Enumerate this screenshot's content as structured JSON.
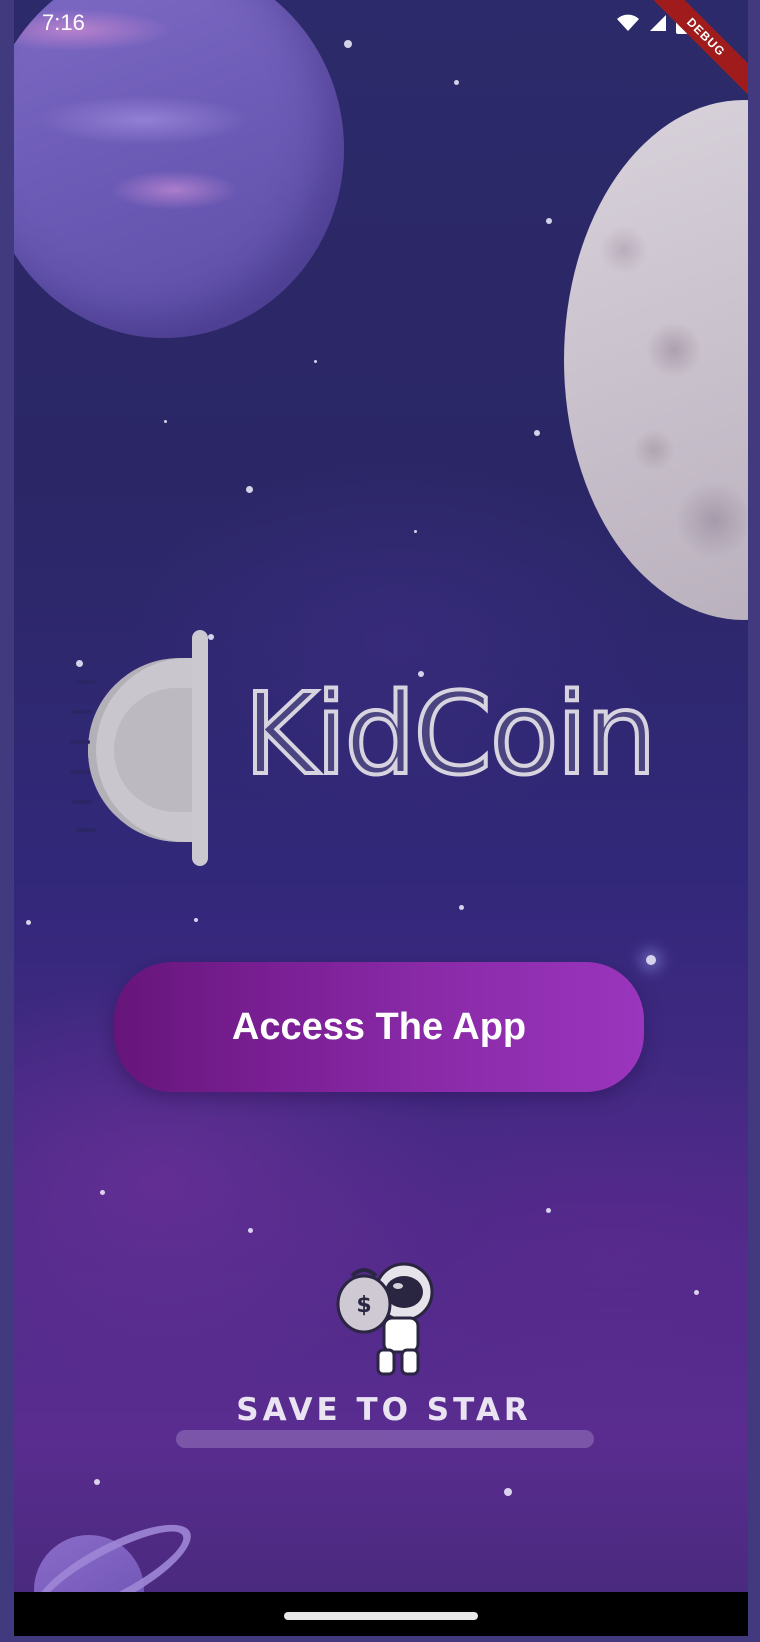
{
  "status_bar": {
    "time": "7:16",
    "icons": [
      "wifi-icon",
      "signal-icon",
      "battery-icon"
    ],
    "debug_banner": "DEBUG"
  },
  "logo": {
    "text": "KidCoin",
    "icon": "coin-icon"
  },
  "primary_button": {
    "label": "Access The App"
  },
  "footer": {
    "mascot": "astronaut-money-bag-icon",
    "tagline": "SAVE TO STAR"
  },
  "colors": {
    "button_gradient_start": "#66157a",
    "button_gradient_end": "#9a35bd",
    "background": "#2b2766"
  }
}
